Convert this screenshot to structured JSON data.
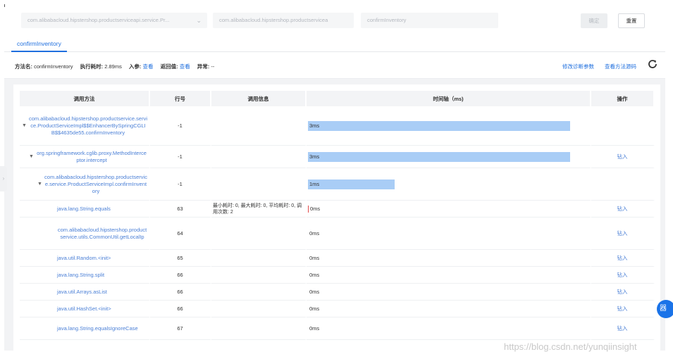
{
  "toolbar": {
    "class_select": "com.alibabacloud.hipstershop.productserviceapi.service.Pr...",
    "impl_select": "com.alibabacloud.hipstershop.productservicea",
    "method_select": "confirmInventory",
    "confirm_label": "确定",
    "reset_label": "重置"
  },
  "tabs": [
    {
      "label": "confirmInventory"
    }
  ],
  "info": {
    "method_label": "方法名:",
    "method_value": "confirmInventory",
    "time_label": "执行耗时:",
    "time_value": "2.89ms",
    "args_label": "入参:",
    "args_link": "查看",
    "ret_label": "返回值:",
    "ret_link": "查看",
    "exc_label": "异常:",
    "exc_value": "--",
    "modify_link": "修改诊断参数",
    "source_link": "查看方法源码",
    "refresh_icon": "refresh-icon"
  },
  "table": {
    "headers": [
      "调用方法",
      "行号",
      "调用信息",
      "时间轴（ms)",
      "操作"
    ],
    "rows": [
      {
        "method": "com.alibabacloud.hipstershop.productservice.service.ProductServiceImpl$$EnhancerBySpringCGLIB$$4635de55.confirmInventory",
        "line": "-1",
        "info": "",
        "time": "3ms",
        "fraction": 1.0,
        "op": ""
      },
      {
        "method": "org.springframework.cglib.proxy.MethodInterceptor.intercept",
        "line": "-1",
        "info": "",
        "time": "3ms",
        "fraction": 1.0,
        "op": "钻入"
      },
      {
        "method": "com.alibabacloud.hipstershop.productservice.service.ProductServiceImpl.confirmInventory",
        "line": "-1",
        "info": "",
        "time": "1ms",
        "fraction": 0.33,
        "op": ""
      },
      {
        "method": "java.lang.String.equals",
        "line": "63",
        "info": "最小耗时: 0, 最大耗时: 0, 平均耗时: 0, 调用次数: 2",
        "time": "0ms",
        "fraction": 0,
        "op": "钻入"
      },
      {
        "method": "com.alibabacloud.hipstershop.productservice.utils.CommonUtil.getLocalIp",
        "line": "64",
        "info": "",
        "time": "0ms",
        "fraction": 0,
        "op": "钻入"
      },
      {
        "method": "java.util.Random.<init>",
        "line": "65",
        "info": "",
        "time": "0ms",
        "fraction": 0,
        "op": "钻入"
      },
      {
        "method": "java.lang.String.split",
        "line": "66",
        "info": "",
        "time": "0ms",
        "fraction": 0,
        "op": "钻入"
      },
      {
        "method": "java.util.Arrays.asList",
        "line": "66",
        "info": "",
        "time": "0ms",
        "fraction": 0,
        "op": "钻入"
      },
      {
        "method": "java.util.HashSet.<init>",
        "line": "66",
        "info": "",
        "time": "0ms",
        "fraction": 0,
        "op": "钻入"
      },
      {
        "method": "java.lang.String.equalsIgnoreCase",
        "line": "67",
        "info": "",
        "time": "0ms",
        "fraction": 0,
        "op": "钻入"
      }
    ]
  },
  "fab_label": "器",
  "watermark": "https://blog.csdn.net/yunqiinsight"
}
